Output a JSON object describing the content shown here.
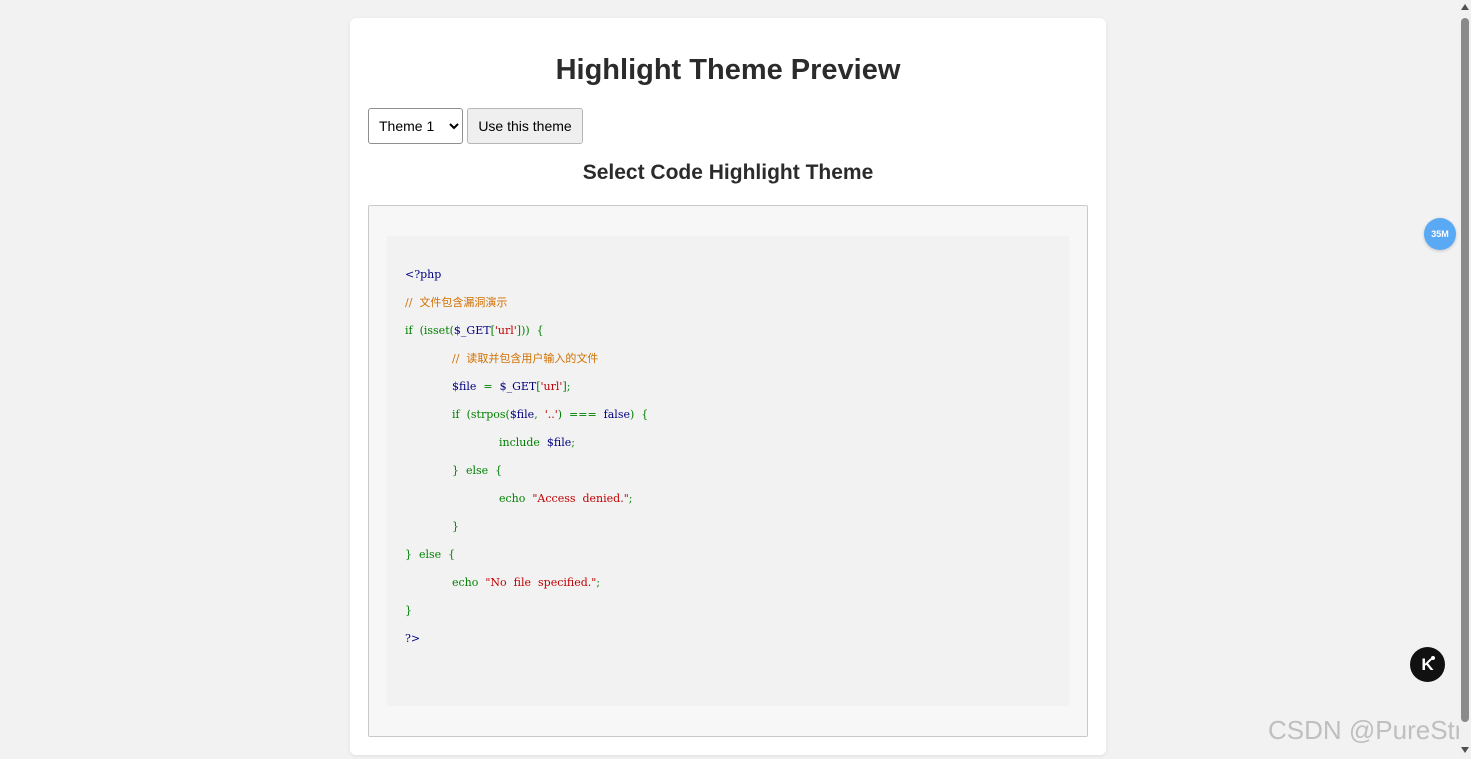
{
  "page": {
    "title": "Highlight Theme Preview",
    "section_title": "Select Code Highlight Theme"
  },
  "controls": {
    "theme_options": [
      "Theme 1"
    ],
    "selected_theme": "Theme 1",
    "use_button_label": "Use this theme"
  },
  "code": {
    "lines": [
      [
        {
          "t": "<?php",
          "c": "navy"
        }
      ],
      [
        {
          "t": "//  文件包含漏洞演示",
          "c": "orange"
        }
      ],
      [
        {
          "t": "if  (isset(",
          "c": "green"
        },
        {
          "t": "$_GET",
          "c": "navy"
        },
        {
          "t": "[",
          "c": "green"
        },
        {
          "t": "'url'",
          "c": "red"
        },
        {
          "t": "]))  {",
          "c": "green"
        }
      ],
      [
        {
          "t": "//  读取并包含用户输入的文件",
          "c": "orange"
        }
      ],
      [
        {
          "t": "$file",
          "c": "navy"
        },
        {
          "t": "  =  ",
          "c": "green"
        },
        {
          "t": "$_GET",
          "c": "navy"
        },
        {
          "t": "[",
          "c": "green"
        },
        {
          "t": "'url'",
          "c": "red"
        },
        {
          "t": "];",
          "c": "green"
        }
      ],
      [
        {
          "t": "if  (strpos(",
          "c": "green"
        },
        {
          "t": "$file",
          "c": "navy"
        },
        {
          "t": ",  ",
          "c": "green"
        },
        {
          "t": "'..'",
          "c": "red"
        },
        {
          "t": ")  ===  ",
          "c": "green"
        },
        {
          "t": "false",
          "c": "navy"
        },
        {
          "t": ")  {",
          "c": "green"
        }
      ],
      [
        {
          "t": "include  ",
          "c": "green"
        },
        {
          "t": "$file",
          "c": "navy"
        },
        {
          "t": ";",
          "c": "green"
        }
      ],
      [
        {
          "t": "}  else  {",
          "c": "green"
        }
      ],
      [
        {
          "t": "echo  ",
          "c": "green"
        },
        {
          "t": "\"Access  denied.\"",
          "c": "red"
        },
        {
          "t": ";",
          "c": "green"
        }
      ],
      [
        {
          "t": "}",
          "c": "green"
        }
      ],
      [
        {
          "t": "}  else  {",
          "c": "green"
        }
      ],
      [
        {
          "t": "echo  ",
          "c": "green"
        },
        {
          "t": "\"No  file  specified.\"",
          "c": "red"
        },
        {
          "t": ";",
          "c": "green"
        }
      ],
      [
        {
          "t": "}",
          "c": "green"
        }
      ],
      [
        {
          "t": "?>",
          "c": "navy"
        }
      ]
    ]
  },
  "overlays": {
    "memory_badge": "35M",
    "k_icon_letter": "K",
    "watermark": "CSDN @PureStr"
  },
  "colors": {
    "navy": "#000080",
    "green": "#008000",
    "orange": "#d27000",
    "red": "#c00000",
    "badge": "#5aa9f5"
  }
}
